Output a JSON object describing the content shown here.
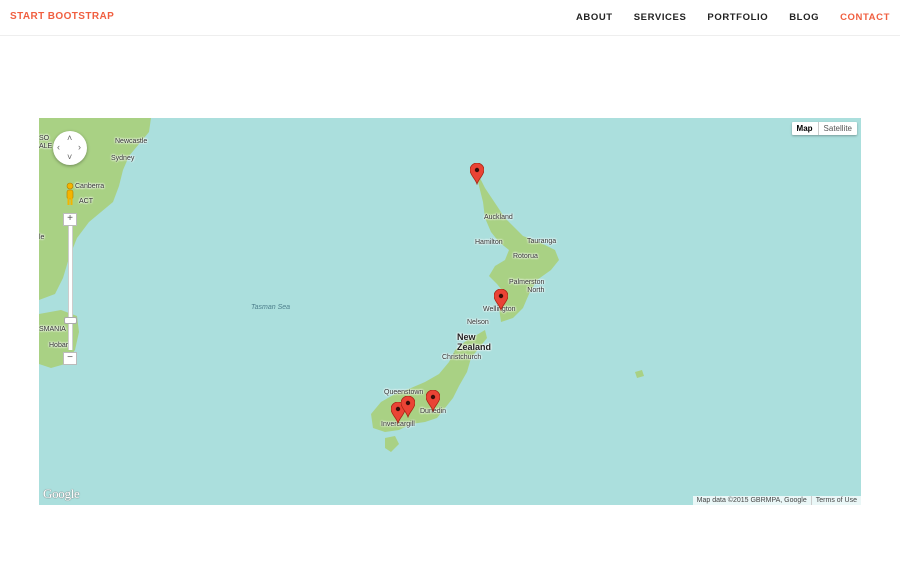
{
  "navbar": {
    "brand": "START BOOTSTRAP",
    "brand_color": "#f05f40",
    "links": [
      {
        "label": "ABOUT",
        "active": false
      },
      {
        "label": "SERVICES",
        "active": false
      },
      {
        "label": "PORTFOLIO",
        "active": false
      },
      {
        "label": "BLOG",
        "active": false
      },
      {
        "label": "CONTACT",
        "active": true
      }
    ]
  },
  "map": {
    "colors": {
      "water": "#abdfdd",
      "land": "#a9d184",
      "marker": "#ea4335"
    },
    "map_type": {
      "map": "Map",
      "satellite": "Satellite",
      "selected": "Map"
    },
    "zoom": {
      "in": "+",
      "out": "−"
    },
    "places": {
      "newcastle": "Newcastle",
      "sydney": "Sydney",
      "canberra": "Canberra",
      "act": "ACT",
      "new_south_wales_partial": "SO\nALE",
      "victoria_partial": "le",
      "tasmania": "SMANIA",
      "hobart": "Hobart",
      "tasman_sea": "Tasman Sea",
      "auckland": "Auckland",
      "hamilton": "Hamilton",
      "tauranga": "Tauranga",
      "rotorua": "Rotorua",
      "palmerston_north": "Palmerston\nNorth",
      "wellington": "Wellington",
      "nelson": "Nelson",
      "new_zealand": "New\nZealand",
      "christchurch": "Christchurch",
      "queenstown": "Queenstown",
      "dunedin": "Dunedin",
      "invercargill": "Invercargill"
    },
    "markers": [
      {
        "name": "Northland"
      },
      {
        "name": "Wellington"
      },
      {
        "name": "Southland 1"
      },
      {
        "name": "Southland 2"
      },
      {
        "name": "Dunedin"
      }
    ],
    "logo": "Google",
    "attribution": "Map data ©2015 GBRMPA, Google",
    "terms": "Terms of Use"
  }
}
